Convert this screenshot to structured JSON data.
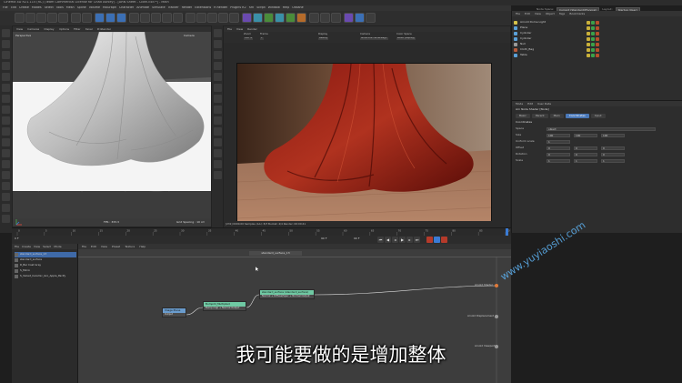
{
  "window": {
    "title": "Cinema 4D R21.115 (RC) (Team Commercial License for Chad Ashley) - [ARN Sheet - Cloth.c4d *] - Main"
  },
  "menubar": [
    "File",
    "Edit",
    "Create",
    "Modes",
    "Select",
    "Tools",
    "Mesh",
    "Spline",
    "Volume",
    "MoGraph",
    "Character",
    "Animate",
    "Simulate",
    "Tracker",
    "Render",
    "Extensions",
    "R Render",
    "Plugins R2",
    "Arn",
    "Script",
    "Window",
    "Help",
    "Ukkane"
  ],
  "layout": {
    "node_space_label": "Node Space:",
    "node_space_value": "Current (Standard/Physical)",
    "layout_label": "Layout:",
    "layout_value": "Startup (User)"
  },
  "viewport": {
    "menu": [
      "View",
      "Cameras",
      "Display",
      "Options",
      "Filter",
      "Panel",
      "ProRender"
    ],
    "label": "Perspective",
    "camera": "Camera",
    "fps": "FPS : 333.3",
    "grid": "Grid Spacing : 10 cm"
  },
  "render_view": {
    "menu": [
      "File",
      "View",
      "Render"
    ],
    "options": [
      {
        "label": "Zoom",
        "value": "100 %"
      },
      {
        "label": "Frame",
        "value": "1"
      },
      {
        "label": "Display",
        "value": "Beauty"
      },
      {
        "label": "Camera",
        "value": "&lt;active camera&gt;"
      },
      {
        "label": "Color Space",
        "value": "sRGB (display)"
      }
    ],
    "status": "[231] 0000.00   Samples (AA): 8/3   Bucket: 4/4   Render: 00:00:41"
  },
  "object_manager": {
    "menu": [
      "File",
      "Edit",
      "View",
      "Object",
      "Tags",
      "Bookmarks"
    ],
    "objects": [
      {
        "name": "Arnold Dome Light",
        "color": "#d6c24a"
      },
      {
        "name": "Plane",
        "color": "#5aa0d8"
      },
      {
        "name": "Cylinder",
        "color": "#5aa0d8"
      },
      {
        "name": "Cylinder",
        "color": "#5aa0d8"
      },
      {
        "name": "Null",
        "color": "#9a9a9a"
      },
      {
        "name": "Cloth_Bag",
        "color": "#b85a3a"
      },
      {
        "name": "Table",
        "color": "#5aa0d8"
      }
    ]
  },
  "attributes": {
    "menu": [
      "Mode",
      "Edit",
      "User Data"
    ],
    "title": "Arn Node Shader [Node]",
    "tabs": [
      "Basic",
      "Parent",
      "Main",
      "Coordinates",
      "Input"
    ],
    "active_tab": "Coordinates",
    "section": "Coordinates",
    "rows": [
      {
        "label": "Space",
        "values": [
          "object"
        ]
      },
      {
        "label": "Size",
        "values": [
          "100",
          "100",
          "100"
        ]
      },
      {
        "label": "Uniform scale",
        "values": [
          "1"
        ]
      },
      {
        "label": "Offset",
        "values": [
          "0",
          "0",
          "0"
        ]
      },
      {
        "label": "Rotation",
        "values": [
          "0",
          "0",
          "0"
        ]
      },
      {
        "label": "Scale",
        "values": [
          "1",
          "1",
          "1"
        ]
      }
    ]
  },
  "timeline": {
    "ticks": [
      "0",
      "5",
      "10",
      "15",
      "20",
      "25",
      "30",
      "35",
      "40",
      "45",
      "50",
      "55",
      "60",
      "65",
      "70",
      "75",
      "80",
      "85",
      "90"
    ],
    "start": "0 F",
    "end": "90 F",
    "current": "90 F"
  },
  "node_list": {
    "menu": [
      "File",
      "Create",
      "View",
      "Select",
      "Mode"
    ],
    "items": [
      {
        "name": "standard_surface_13",
        "selected": true
      },
      {
        "name": "standard_surface"
      },
      {
        "name": "R_Bar Coat Gray"
      },
      {
        "name": "S_Mirror"
      },
      {
        "name": "S_Velvet_Ceramic_Gro_Apple_Pacify"
      }
    ]
  },
  "node_editor": {
    "menu": [
      "File",
      "Edit",
      "View",
      "Preset",
      "Texture",
      "Help"
    ],
    "tab": "standard_surface_13",
    "nodes": [
      {
        "id": "n1",
        "title": "Image Plane",
        "color": "#6a9ccd",
        "port": "Output"
      },
      {
        "id": "n2",
        "title": "Bump2d_Multiplied",
        "color": "#6fc9a3",
        "port": "Bump map + Normal   Output"
      },
      {
        "id": "n3",
        "title": "standard_surface (standard_surface)",
        "color": "#6fc9a3",
        "port": "Normal + Diffuse/Spec + Normal   Output"
      }
    ],
    "outputs": [
      "Arnold Shader",
      "Arnold Displacement",
      "Arnold Viewport"
    ]
  },
  "subtitle": "我可能要做的是增加整体",
  "watermark": "www.yuyiaoshi.com"
}
